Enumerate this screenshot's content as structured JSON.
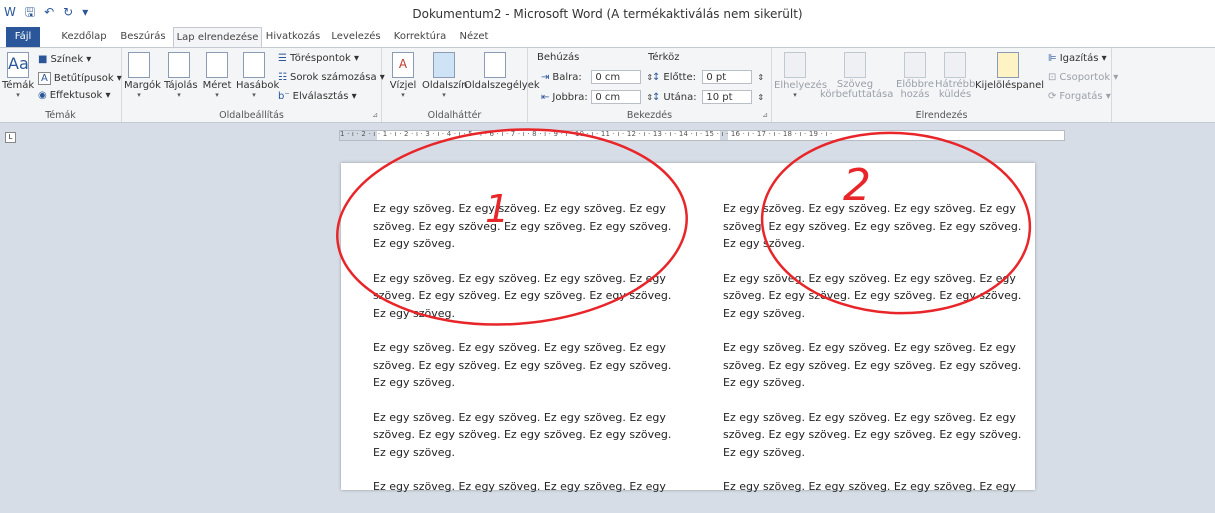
{
  "titlebar": {
    "quick_access": [
      "word-icon",
      "save-icon",
      "undo-icon",
      "redo-icon",
      "customize-icon"
    ],
    "title": "Dokumentum2 - Microsoft Word (A termékaktiválás nem sikerült)"
  },
  "tabs": [
    "Fájl",
    "Kezdőlap",
    "Beszúrás",
    "Lap elrendezése",
    "Hivatkozás",
    "Levelezés",
    "Korrektúra",
    "Nézet"
  ],
  "ribbon": {
    "temak": {
      "label": "Témák",
      "big_button": "Témák",
      "items": [
        "Színek ▾",
        "Betűtípusok ▾",
        "Effektusok ▾"
      ]
    },
    "oldalbeallitas": {
      "label": "Oldalbeállítás",
      "buttons": [
        "Margók",
        "Tájolás",
        "Méret",
        "Hasábok"
      ],
      "items": [
        "Töréspontok ▾",
        "Sorok számozása ▾",
        "Elválasztás ▾"
      ]
    },
    "oldalhatter": {
      "label": "Oldalháttér",
      "buttons": [
        "Vízjel",
        "Oldalszín",
        "Oldalszegélyek"
      ]
    },
    "bekezdes": {
      "label": "Bekezdés",
      "behuzas_title": "Behúzás",
      "balra_label": "Balra:",
      "balra_value": "0 cm",
      "jobbra_label": "Jobbra:",
      "jobbra_value": "0 cm",
      "terkoz_title": "Térköz",
      "elotte_label": "Előtte:",
      "elotte_value": "0 pt",
      "utana_label": "Utána:",
      "utana_value": "10 pt"
    },
    "elrendezes": {
      "label": "Elrendezés",
      "buttons": [
        "Elhelyezés",
        "Szöveg körbefuttatása",
        "Előbbre hozás",
        "Hátrébb küldés",
        "Kijelöléspanel"
      ],
      "items": [
        "Igazítás ▾",
        "Csoportok ▾",
        "Forgatás ▾"
      ]
    }
  },
  "ruler_text": "1 · ı · 2 · ı · 1 · ı · 2 · ı · 3 · ı · 4 · ı · 5 · ı · 6 · ı · 7 · ı · 8 · ı · 9 · ı · 10 · ı · 11 · ı · 12 · ı · 13 · ı · 14 · ı · 15 · ı · 16 · ı · 17 · ı · 18 · ı · 19 · ı ·",
  "document": {
    "column1": [
      "Ez egy szöveg. Ez egy szöveg. Ez egy szöveg. Ez egy szöveg. Ez egy szöveg. Ez egy szöveg. Ez egy szöveg. Ez egy szöveg.",
      "Ez egy szöveg. Ez egy szöveg. Ez egy szöveg. Ez egy szöveg. Ez egy szöveg. Ez egy szöveg. Ez egy szöveg. Ez egy szöveg.",
      "Ez egy szöveg. Ez egy szöveg. Ez egy szöveg. Ez egy szöveg. Ez egy szöveg. Ez egy szöveg. Ez egy szöveg. Ez egy szöveg.",
      "Ez egy szöveg. Ez egy szöveg. Ez egy szöveg. Ez egy szöveg. Ez egy szöveg. Ez egy szöveg. Ez egy szöveg. Ez egy szöveg.",
      "Ez egy szöveg. Ez egy szöveg. Ez egy szöveg. Ez egy"
    ],
    "column2": [
      "Ez egy szöveg. Ez egy szöveg. Ez egy szöveg. Ez egy szöveg. Ez egy szöveg. Ez egy szöveg. Ez egy szöveg. Ez egy szöveg.",
      "Ez egy szöveg. Ez egy szöveg. Ez egy szöveg. Ez egy szöveg. Ez egy szöveg. Ez egy szöveg. Ez egy szöveg. Ez egy szöveg.",
      "Ez egy szöveg. Ez egy szöveg. Ez egy szöveg. Ez egy szöveg. Ez egy szöveg. Ez egy szöveg. Ez egy szöveg. Ez egy szöveg.",
      "Ez egy szöveg. Ez egy szöveg. Ez egy szöveg. Ez egy szöveg. Ez egy szöveg. Ez egy szöveg. Ez egy szöveg. Ez egy szöveg.",
      "Ez egy szöveg. Ez egy szöveg. Ez egy szöveg. Ez egy"
    ]
  },
  "annotations": {
    "label1": "1",
    "label2": "2",
    "color": "#e8262a"
  },
  "colors": {
    "file_tab": "#2b579a",
    "ribbon_bg": "#f4f5f7",
    "workspace_bg": "#d7dde6"
  }
}
